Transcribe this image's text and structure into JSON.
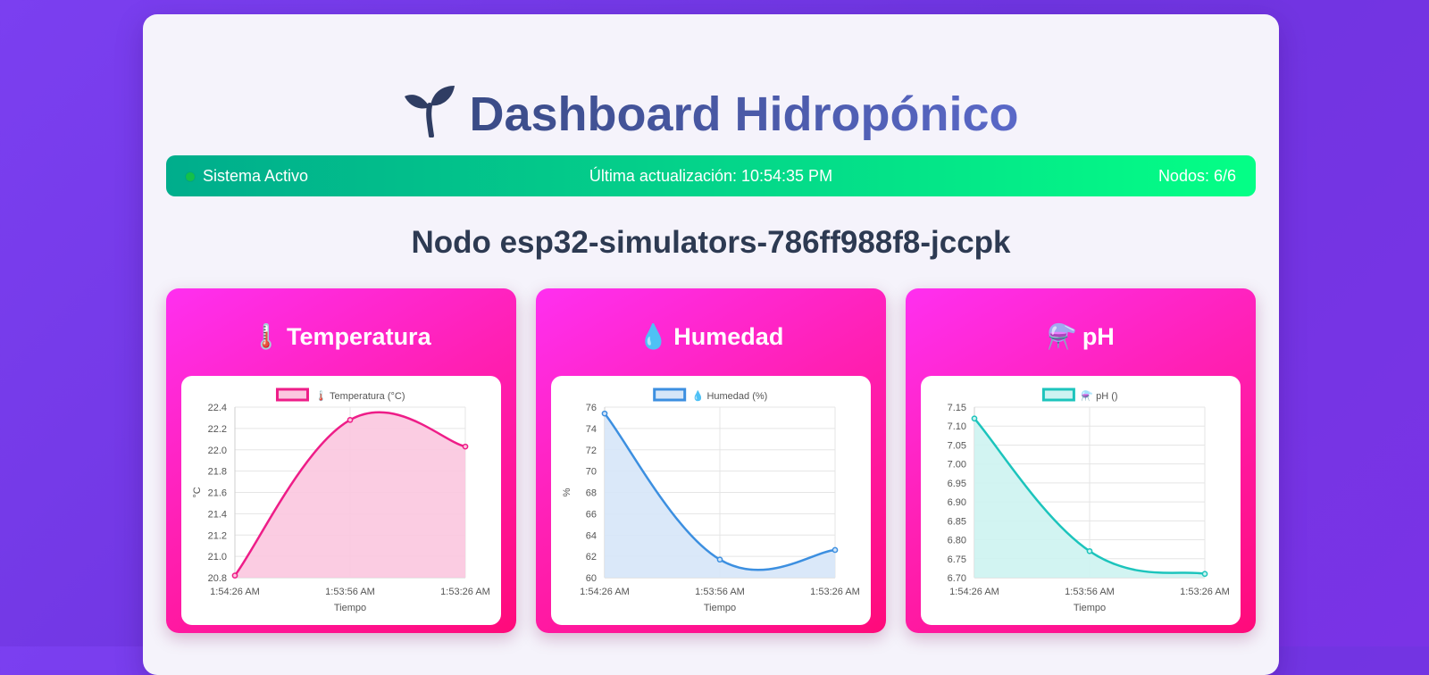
{
  "header": {
    "icon": "sprout-icon",
    "title": "Dashboard Hidropónico"
  },
  "status": {
    "state": "Sistema Activo",
    "indicator_color": "#14c04a",
    "last_update": "Última actualización: 10:54:35 PM",
    "nodes": "Nodos: 6/6"
  },
  "node": {
    "title": "Nodo esp32-simulators-786ff988f8-jccpk"
  },
  "cards": [
    {
      "emoji": "🌡️",
      "label": "Temperatura"
    },
    {
      "emoji": "💧",
      "label": "Humedad"
    },
    {
      "emoji": "⚗️",
      "label": "pH"
    }
  ],
  "chart_data": [
    {
      "type": "line",
      "legend": "🌡️ Temperatura (°C)",
      "x": [
        "1:54:26 AM",
        "1:53:56 AM",
        "1:53:26 AM"
      ],
      "values": [
        20.82,
        22.28,
        22.03
      ],
      "xlabel": "Tiempo",
      "ylabel": "°C",
      "ylim": [
        20.8,
        22.4
      ],
      "yticks": [
        "22.4",
        "22.2",
        "22.0",
        "21.8",
        "21.6",
        "21.4",
        "21.2",
        "21.0",
        "20.8"
      ],
      "color": "#ee1d88",
      "fill": "#fbc6df",
      "grid": true
    },
    {
      "type": "line",
      "legend": "💧 Humedad (%)",
      "x": [
        "1:54:26 AM",
        "1:53:56 AM",
        "1:53:26 AM"
      ],
      "values": [
        75.4,
        61.7,
        62.6
      ],
      "xlabel": "Tiempo",
      "ylabel": "%",
      "ylim": [
        60,
        76
      ],
      "yticks": [
        "76",
        "74",
        "72",
        "70",
        "68",
        "66",
        "64",
        "62",
        "60"
      ],
      "color": "#3c8fe0",
      "fill": "#d6e6f8",
      "grid": true
    },
    {
      "type": "line",
      "legend": "⚗️ pH ()",
      "x": [
        "1:54:26 AM",
        "1:53:56 AM",
        "1:53:26 AM"
      ],
      "values": [
        7.12,
        6.77,
        6.71
      ],
      "xlabel": "Tiempo",
      "ylabel": "",
      "ylim": [
        6.7,
        7.15
      ],
      "yticks": [
        "7.15",
        "7.10",
        "7.05",
        "7.00",
        "6.95",
        "6.90",
        "6.85",
        "6.80",
        "6.75",
        "6.70"
      ],
      "color": "#1cc4bc",
      "fill": "#cdf3f1",
      "grid": true
    }
  ]
}
